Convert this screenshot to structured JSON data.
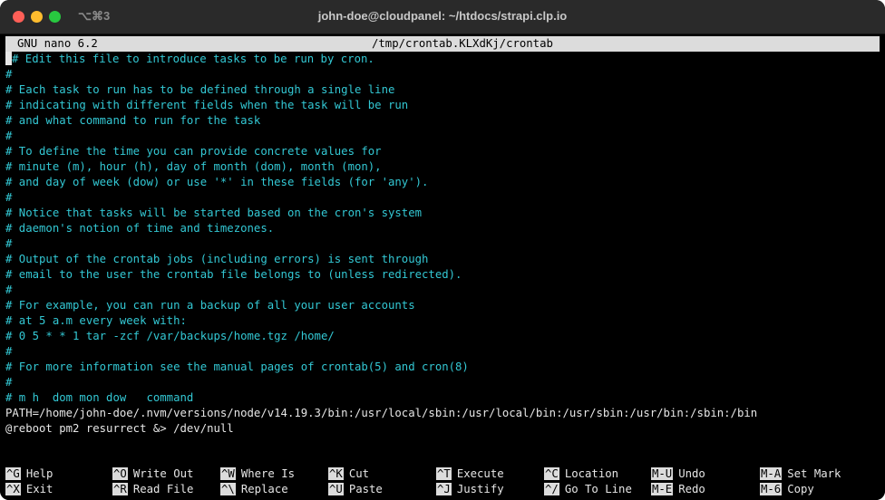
{
  "window": {
    "title": "john-doe@cloudpanel: ~/htdocs/strapi.clp.io",
    "shortcut": "⌥⌘3"
  },
  "nano": {
    "version": "GNU nano 6.2",
    "file": "/tmp/crontab.KLXdKj/crontab"
  },
  "lines": [
    {
      "text": "# Edit this file to introduce tasks to be run by cron.",
      "type": "comment"
    },
    {
      "text": "#",
      "type": "comment"
    },
    {
      "text": "# Each task to run has to be defined through a single line",
      "type": "comment"
    },
    {
      "text": "# indicating with different fields when the task will be run",
      "type": "comment"
    },
    {
      "text": "# and what command to run for the task",
      "type": "comment"
    },
    {
      "text": "#",
      "type": "comment"
    },
    {
      "text": "# To define the time you can provide concrete values for",
      "type": "comment"
    },
    {
      "text": "# minute (m), hour (h), day of month (dom), month (mon),",
      "type": "comment"
    },
    {
      "text": "# and day of week (dow) or use '*' in these fields (for 'any').",
      "type": "comment"
    },
    {
      "text": "#",
      "type": "comment"
    },
    {
      "text": "# Notice that tasks will be started based on the cron's system",
      "type": "comment"
    },
    {
      "text": "# daemon's notion of time and timezones.",
      "type": "comment"
    },
    {
      "text": "#",
      "type": "comment"
    },
    {
      "text": "# Output of the crontab jobs (including errors) is sent through",
      "type": "comment"
    },
    {
      "text": "# email to the user the crontab file belongs to (unless redirected).",
      "type": "comment"
    },
    {
      "text": "#",
      "type": "comment"
    },
    {
      "text": "# For example, you can run a backup of all your user accounts",
      "type": "comment"
    },
    {
      "text": "# at 5 a.m every week with:",
      "type": "comment"
    },
    {
      "text": "# 0 5 * * 1 tar -zcf /var/backups/home.tgz /home/",
      "type": "comment"
    },
    {
      "text": "#",
      "type": "comment"
    },
    {
      "text": "# For more information see the manual pages of crontab(5) and cron(8)",
      "type": "comment"
    },
    {
      "text": "#",
      "type": "comment"
    },
    {
      "text": "# m h  dom mon dow   command",
      "type": "comment"
    },
    {
      "text": "PATH=/home/john-doe/.nvm/versions/node/v14.19.3/bin:/usr/local/sbin:/usr/local/bin:/usr/sbin:/usr/bin:/sbin:/bin",
      "type": "plain"
    },
    {
      "text": "@reboot pm2 resurrect &> /dev/null",
      "type": "plain"
    }
  ],
  "shortcuts": [
    {
      "key": "^G",
      "label": "Help"
    },
    {
      "key": "^X",
      "label": "Exit"
    },
    {
      "key": "^O",
      "label": "Write Out"
    },
    {
      "key": "^R",
      "label": "Read File"
    },
    {
      "key": "^W",
      "label": "Where Is"
    },
    {
      "key": "^\\",
      "label": "Replace"
    },
    {
      "key": "^K",
      "label": "Cut"
    },
    {
      "key": "^U",
      "label": "Paste"
    },
    {
      "key": "^T",
      "label": "Execute"
    },
    {
      "key": "^J",
      "label": "Justify"
    },
    {
      "key": "^C",
      "label": "Location"
    },
    {
      "key": "^/",
      "label": "Go To Line"
    },
    {
      "key": "M-U",
      "label": "Undo"
    },
    {
      "key": "M-E",
      "label": "Redo"
    },
    {
      "key": "M-A",
      "label": "Set Mark"
    },
    {
      "key": "M-6",
      "label": "Copy"
    }
  ]
}
